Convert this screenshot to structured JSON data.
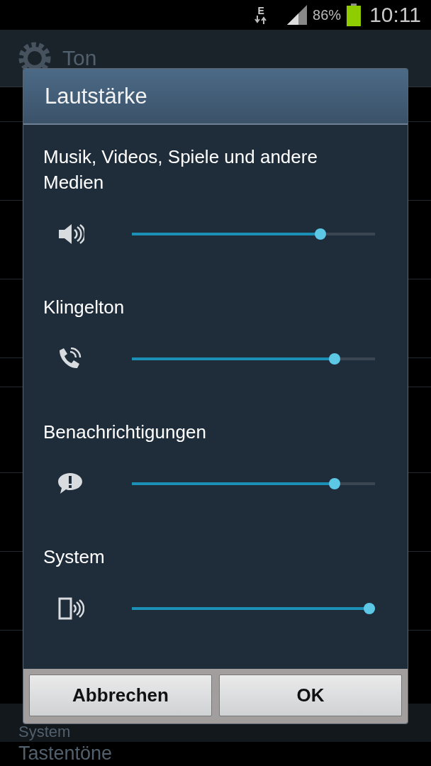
{
  "status_bar": {
    "network": "E",
    "battery_text": "86%",
    "time": "10:11"
  },
  "background": {
    "title": "Ton",
    "section": "System",
    "item": "Tastentöne"
  },
  "dialog": {
    "title": "Lautstärke",
    "channels": [
      {
        "kind": "media",
        "name": "Musik, Videos, Spiele und andere Medien",
        "level": 0.79
      },
      {
        "kind": "ring",
        "name": "Klingelton",
        "level": 0.85
      },
      {
        "kind": "notification",
        "name": "Benachrichtigungen",
        "level": 0.85
      },
      {
        "kind": "system",
        "name": "System",
        "level": 1
      }
    ],
    "buttons": [
      "Abbrechen",
      "OK"
    ]
  }
}
